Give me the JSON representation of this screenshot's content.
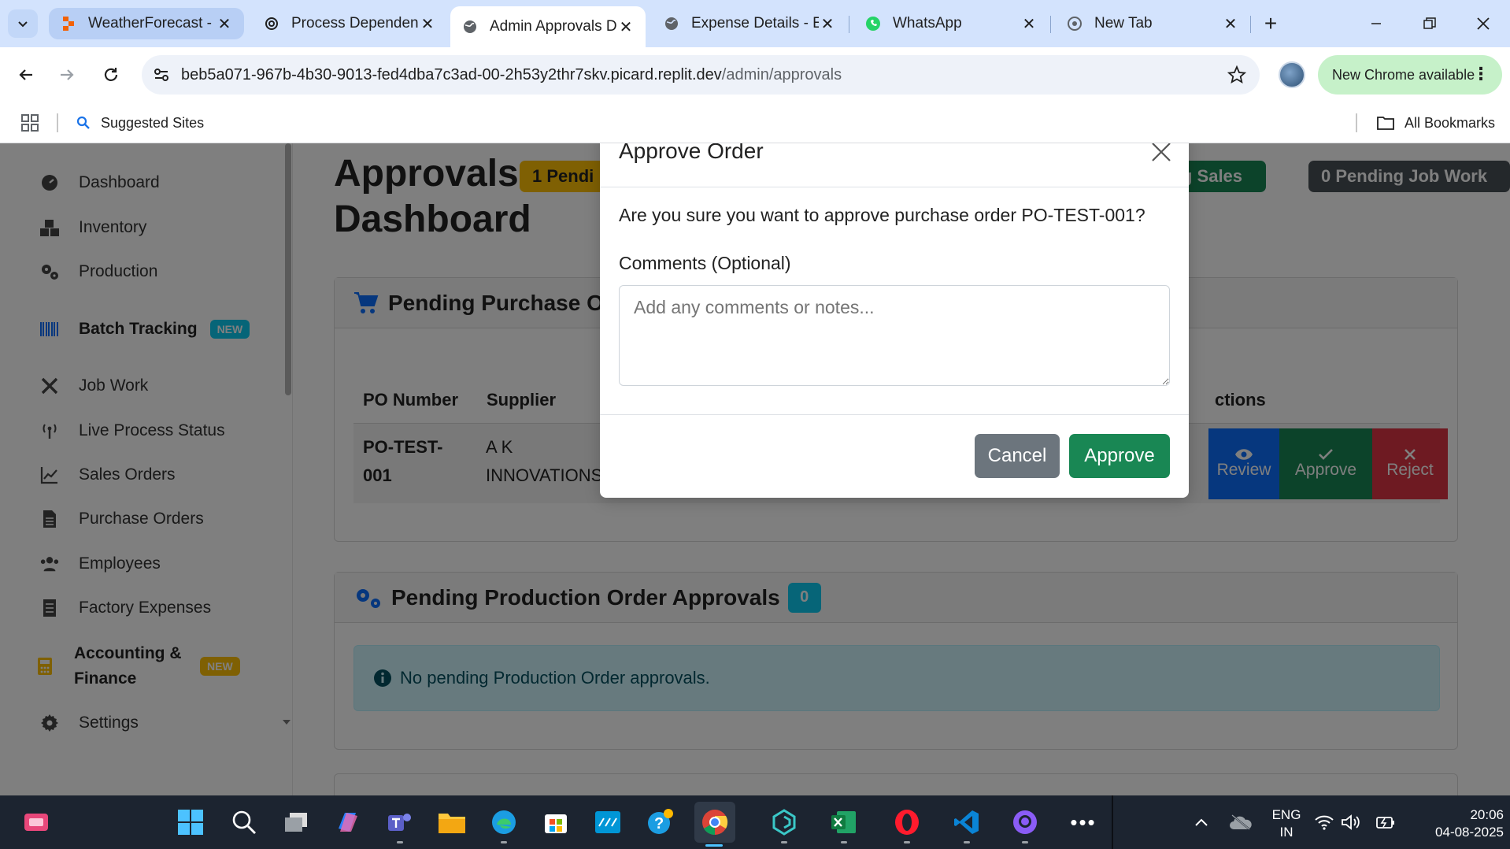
{
  "browser": {
    "tabs": [
      {
        "title": "WeatherForecast -"
      },
      {
        "title": "Process Dependen"
      },
      {
        "title": "Admin Approvals D"
      },
      {
        "title": "Expense Details - E"
      },
      {
        "title": "WhatsApp"
      },
      {
        "title": "New Tab"
      }
    ],
    "url_host": "beb5a071-967b-4b30-9013-fed4dba7c3ad-00-2h53y2thr7skv.picard.replit.dev",
    "url_path": "/admin/approvals",
    "new_chrome_label": "New Chrome available",
    "bookmarks": {
      "suggested": "Suggested Sites",
      "all": "All Bookmarks"
    }
  },
  "sidebar": {
    "items": [
      {
        "label": "Dashboard",
        "icon": "dashboard-icon"
      },
      {
        "label": "Inventory",
        "icon": "boxes-icon"
      },
      {
        "label": "Production",
        "icon": "cogs-icon"
      },
      {
        "label": "Batch Tracking",
        "icon": "barcode-icon",
        "badge": "NEW"
      },
      {
        "label": "Job Work",
        "icon": "tools-icon"
      },
      {
        "label": "Live Process Status",
        "icon": "broadcast-icon"
      },
      {
        "label": "Sales Orders",
        "icon": "chart-line-icon"
      },
      {
        "label": "Purchase Orders",
        "icon": "file-icon"
      },
      {
        "label": "Employees",
        "icon": "users-icon"
      },
      {
        "label": "Factory Expenses",
        "icon": "receipt-icon"
      },
      {
        "label": "Accounting &",
        "label2": "Finance",
        "icon": "calculator-icon",
        "badge": "NEW"
      },
      {
        "label": "Settings",
        "icon": "gear-icon"
      }
    ]
  },
  "main": {
    "title_line1": "Approvals",
    "title_line2": "Dashboard",
    "pills": {
      "pending": "1 Pendi",
      "sales": "ding Sales",
      "job_work": "0 Pending Job Work"
    },
    "po_card": {
      "title": "Pending Purchase O",
      "headers": {
        "po_number": "PO Number",
        "supplier": "Supplier",
        "actions": "ctions"
      },
      "row": {
        "po_line1": "PO-TEST-",
        "po_line2": "001",
        "supplier_line1": "A K",
        "supplier_line2": "INNOVATIONS"
      },
      "actions": {
        "review": "Review",
        "approve": "Approve",
        "reject": "Reject"
      }
    },
    "production_card": {
      "title": "Pending Production Order Approvals",
      "count": "0",
      "empty_message": "No pending Production Order approvals."
    }
  },
  "modal": {
    "title": "Approve Order",
    "message": "Are you sure you want to approve purchase order PO-TEST-001?",
    "comments_label": "Comments (Optional)",
    "comments_placeholder": "Add any comments or notes...",
    "cancel": "Cancel",
    "approve": "Approve"
  },
  "taskbar": {
    "lang1": "ENG",
    "lang2": "IN",
    "time": "20:06",
    "date": "04-08-2025"
  },
  "colors": {
    "success": "#198754",
    "danger": "#dc3545",
    "primary": "#0d6efd",
    "secondary": "#6c757d",
    "info": "#0dcaf0",
    "warning": "#ffc107"
  }
}
